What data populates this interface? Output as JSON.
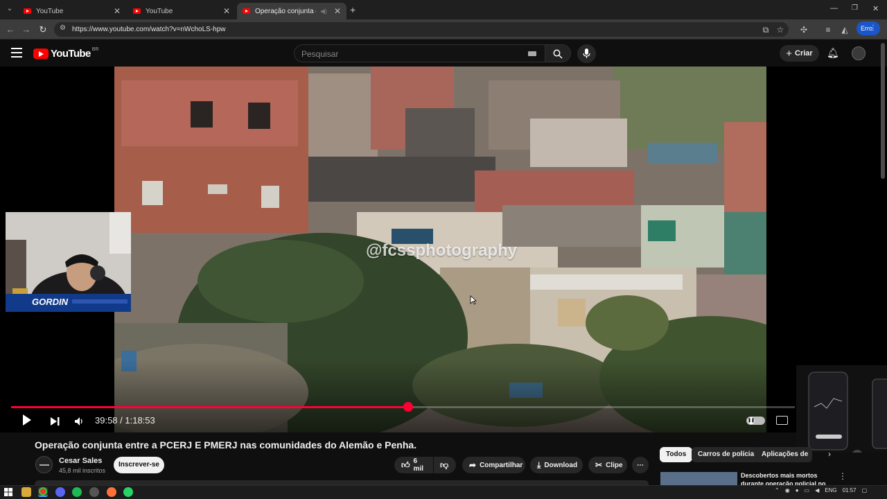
{
  "browser": {
    "tabs": [
      {
        "title": "YouTube",
        "active": false
      },
      {
        "title": "YouTube",
        "active": false
      },
      {
        "title": "Operação conjunta entre a",
        "active": true
      }
    ],
    "url": "https://www.youtube.com/watch?v=nWchoLS-hpw",
    "profile_label": "Erro"
  },
  "youtube": {
    "logo_text": "YouTube",
    "country_code": "BR",
    "search_placeholder": "Pesquisar",
    "create_label": "Criar"
  },
  "player": {
    "watermark": "@fcssphotography",
    "streamer_name": "GORDIN",
    "time_current": "39:58",
    "time_total": "1:18:53",
    "time_display": "39:58 / 1:18:53",
    "progress_fraction": 0.5066
  },
  "video": {
    "title": "Operação conjunta entre a PCERJ E PMERJ nas comunidades do Alemão e Penha.",
    "channel_name": "Cesar Sales",
    "subscribers": "45,8 mil inscritos",
    "subscribe_label": "Inscrever-se",
    "likes": "6 mil",
    "share_label": "Compartilhar",
    "download_label": "Download",
    "clip_label": "Clipe"
  },
  "sidebar": {
    "chips": [
      "Todos",
      "Carros de polícia",
      "Aplicações de"
    ],
    "rec_title": "Descobertos mais mortos durante operação policial no"
  },
  "taskbar": {
    "lang": "ENG",
    "time": "01:57"
  },
  "colors": {
    "accent": "#ff0033",
    "youtube_red": "#ff0000",
    "background": "#0f0f0f",
    "profile": "#1a56c8"
  }
}
